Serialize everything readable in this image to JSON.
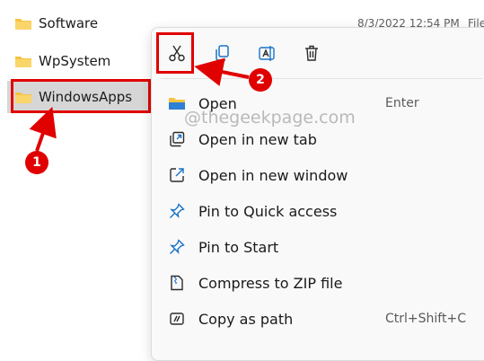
{
  "files": [
    {
      "name": "Software",
      "date": "8/3/2022 12:54 PM",
      "type": "File"
    },
    {
      "name": "WpSystem"
    },
    {
      "name": "WindowsApps"
    }
  ],
  "context_menu": {
    "toolbar": [
      {
        "icon": "cut-icon",
        "label": "Cut"
      },
      {
        "icon": "copy-icon",
        "label": "Copy"
      },
      {
        "icon": "rename-icon",
        "label": "Rename"
      },
      {
        "icon": "delete-icon",
        "label": "Delete"
      }
    ],
    "items": [
      {
        "icon": "open-folder-icon",
        "label": "Open",
        "shortcut": "Enter"
      },
      {
        "icon": "new-tab-icon",
        "label": "Open in new tab",
        "shortcut": ""
      },
      {
        "icon": "new-window-icon",
        "label": "Open in new window",
        "shortcut": ""
      },
      {
        "icon": "pin-icon",
        "label": "Pin to Quick access",
        "shortcut": ""
      },
      {
        "icon": "pin-icon",
        "label": "Pin to Start",
        "shortcut": ""
      },
      {
        "icon": "zip-icon",
        "label": "Compress to ZIP file",
        "shortcut": ""
      },
      {
        "icon": "copy-path-icon",
        "label": "Copy as path",
        "shortcut": "Ctrl+Shift+C"
      }
    ]
  },
  "watermark": "@thegeekpage.com",
  "annotations": {
    "step1": "1",
    "step2": "2"
  },
  "colors": {
    "annotation_red": "#e00000",
    "folder_yellow": "#f5c342",
    "icon_blue": "#1a73c8",
    "selected_row": "#d6d6d6"
  }
}
